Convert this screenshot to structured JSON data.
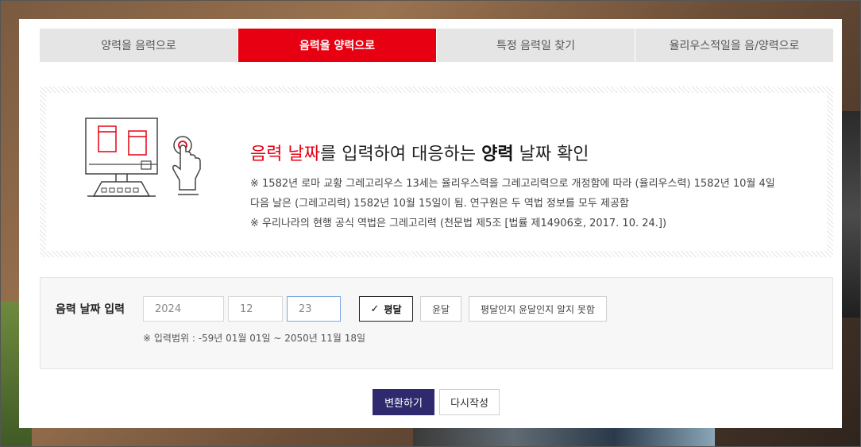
{
  "tabs": [
    {
      "label": "양력을 음력으로",
      "active": false
    },
    {
      "label": "음력을 양력으로",
      "active": true
    },
    {
      "label": "특정 음력일 찾기",
      "active": false
    },
    {
      "label": "율리우스적일을 음/양력으로",
      "active": false
    }
  ],
  "info": {
    "headline_red": "음력 날짜",
    "headline_mid": "를 입력하여 대응하는 ",
    "headline_bold": "양력",
    "headline_end": " 날짜 확인",
    "note1": "※ 1582년 로마 교황 그레고리우스 13세는 율리우스력을 그레고리력으로 개정함에 따라 (율리우스력) 1582년 10월 4일",
    "note2": "다음 날은 (그레고리력) 1582년 10월 15일이 됨. 연구원은 두 역법 정보를 모두 제공함",
    "note3": "※ 우리나라의 현행 공식 역법은 그레고리력 (천문법 제5조 [법률 제14906호, 2017. 10. 24.])"
  },
  "form": {
    "label": "음력 날짜 입력",
    "year": "2024",
    "month": "12",
    "day": "23",
    "options": {
      "normal": "평달",
      "leap": "윤달",
      "unknown": "평달인지 윤달인지 알지 못함"
    },
    "selected_option": "normal",
    "range_note": "※ 입력범위 : -59년 01월 01일 ~ 2050년 11월 18일"
  },
  "buttons": {
    "convert": "변환하기",
    "reset": "다시작성"
  },
  "colors": {
    "accent_red": "#e60012",
    "primary_button": "#2f2a6e"
  }
}
